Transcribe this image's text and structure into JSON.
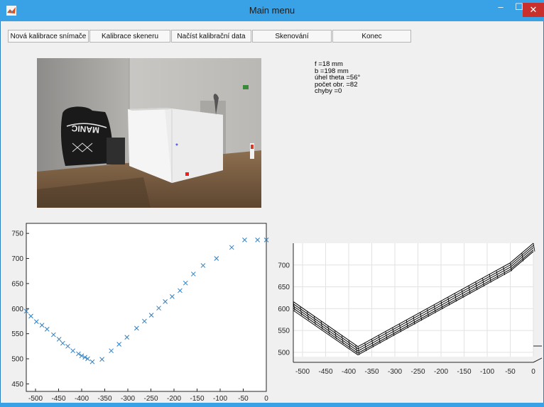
{
  "window": {
    "title": "Main menu",
    "colors": {
      "titlebar": "#39a2e6",
      "close": "#c9302c",
      "client": "#f0f0f0"
    }
  },
  "window_controls": {
    "minimize": "‒",
    "maximize": "☐",
    "close": "✕"
  },
  "toolbar": {
    "buttons": [
      {
        "label": "Nová kalibrace snímače"
      },
      {
        "label": "Kalibrace skeneru"
      },
      {
        "label": "Načíst kalibrační data"
      },
      {
        "label": "Skenování"
      },
      {
        "label": "Konec"
      }
    ]
  },
  "photo": {
    "icon": "matlab-icon",
    "box_label": "MANIC"
  },
  "info": {
    "f": "f =18 mm",
    "b": "b =198 mm",
    "theta": "úhel theta =56°",
    "count": "počet obr. =82",
    "errors": "chyby =0"
  },
  "chart_data": [
    {
      "type": "scatter",
      "marker": "x",
      "color": "#2f7fc1",
      "xlim": [
        -520,
        0
      ],
      "ylim": [
        435,
        770
      ],
      "xticks": [
        -500,
        -450,
        -400,
        -350,
        -300,
        -250,
        -200,
        -150,
        -100,
        -50,
        0
      ],
      "yticks": [
        450,
        500,
        550,
        600,
        650,
        700,
        750
      ],
      "x": [
        -520,
        -510,
        -498,
        -486,
        -475,
        -461,
        -449,
        -441,
        -430,
        -419,
        -407,
        -400,
        -393,
        -387,
        -377,
        -356,
        -336,
        -319,
        -302,
        -281,
        -264,
        -249,
        -233,
        -219,
        -204,
        -187,
        -175,
        -158,
        -137,
        -108,
        -75,
        -47,
        -19,
        0
      ],
      "y": [
        595,
        585,
        574,
        567,
        559,
        548,
        539,
        531,
        525,
        516,
        510,
        506,
        503,
        500,
        494,
        499,
        516,
        529,
        543,
        561,
        575,
        587,
        601,
        614,
        624,
        636,
        651,
        669,
        686,
        700,
        722,
        737,
        737,
        737
      ]
    },
    {
      "type": "line",
      "subtype": "surface-mesh",
      "color": "#000000",
      "xlim": [
        -520,
        0
      ],
      "ylim": [
        490,
        750
      ],
      "xticks": [
        -500,
        -450,
        -400,
        -350,
        -300,
        -250,
        -200,
        -150,
        -100,
        -50,
        0
      ],
      "yticks": [
        500,
        550,
        600,
        650,
        700
      ],
      "x": [
        -520,
        -380,
        -50,
        0
      ],
      "series": [
        {
          "values": [
            616,
            513,
            705,
            750
          ]
        },
        {
          "values": [
            611,
            508,
            700,
            745
          ]
        },
        {
          "values": [
            606,
            503,
            695,
            740
          ]
        },
        {
          "values": [
            601,
            498,
            690,
            735
          ]
        },
        {
          "values": [
            596,
            494,
            686,
            731
          ]
        }
      ]
    }
  ]
}
